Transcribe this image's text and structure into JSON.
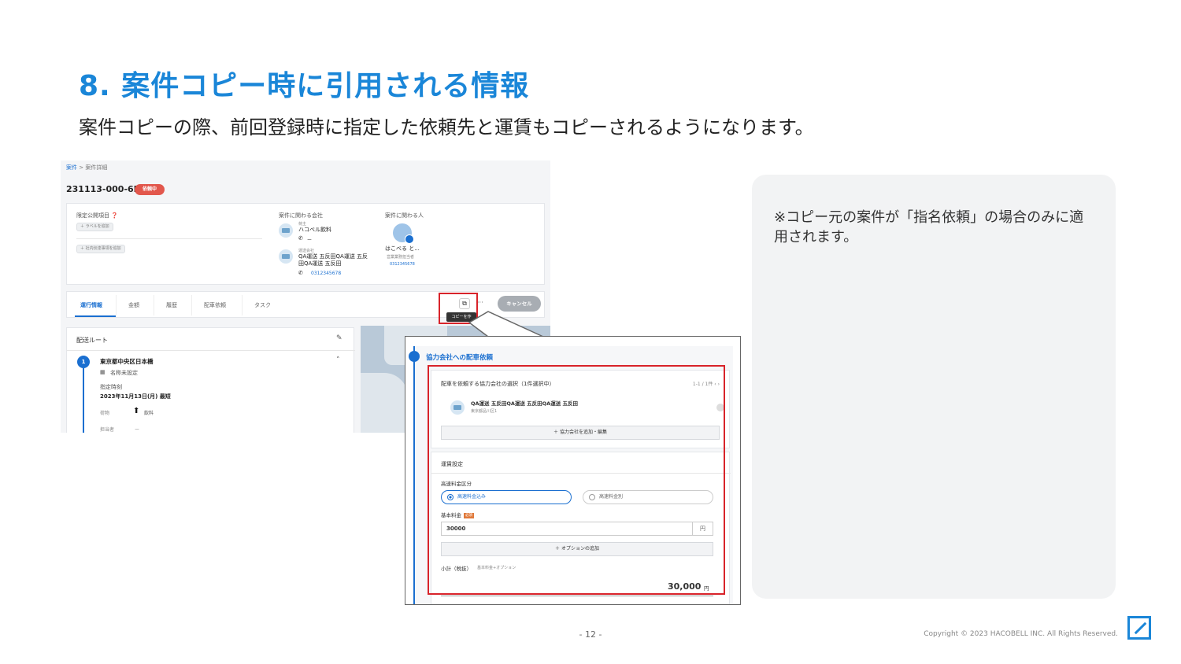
{
  "slide": {
    "title": "8. 案件コピー時に引用される情報",
    "subtitle": "案件コピーの際、前回登録時に指定した依頼先と運賃もコピーされるようになります。",
    "note": "※コピー元の案件が「指名依頼」の場合のみに適用されます。",
    "page_number": "- 12 -",
    "copyright": "Copyright © 2023 HACOBELL INC. All Rights Reserved."
  },
  "screen": {
    "breadcrumb": {
      "root": "案件",
      "sep": ">",
      "current": "案件詳細"
    },
    "case_id": "231113-000-6BR",
    "status": "依頼中",
    "info": {
      "limited_label": "限定公開項目 ❓",
      "add_label_pill": "＋ ラベルを追加",
      "add_internal_pill": "＋ 社内伝達事項を追加",
      "companies_label": "案件に関わる会社",
      "company1_role": "荷主",
      "company1_name": "ハコベル飲料",
      "company1_phone": "ー",
      "company2_role": "運送会社",
      "company2_name": "QA運送 五反田QA運送 五反田QA運送 五反田",
      "company2_phone": "0312345678",
      "people_label": "案件に関わる人",
      "person_name": "はこべる と...",
      "person_dept": "営業業務担当者",
      "person_phone": "0312345678"
    },
    "tabs": [
      "運行情報",
      "金額",
      "履歴",
      "配車依頼",
      "タスク"
    ],
    "copy_tooltip": "コピーを作",
    "more": "···",
    "cancel": "キャンセル",
    "route": {
      "title": "配送ルート",
      "stop_number": "1",
      "stop_name": "東京都中央区日本橋",
      "place_name": "名称未設定",
      "time_label": "指定時刻",
      "time_value": "2023年11月13日(月) 最短",
      "cargo_label": "荷物",
      "cargo_value": "飲料",
      "handler_label": "担当者",
      "handler_value": "ー"
    }
  },
  "zoom": {
    "header": "協力会社への配車依頼",
    "select_title": "配車を依頼する協力会社の選択（1件選択中）",
    "pagination": "1-1 / 1件   ‹   ›",
    "partner_name": "QA運送 五反田QA運送 五反田QA運送 五反田",
    "partner_address": "東京都品川区1",
    "add_partner": "＋ 協力会社を追加・編集",
    "fare_title": "運賃設定",
    "toll_label": "高速料金区分",
    "toll_included": "高速料金込み",
    "toll_excluded": "高速料金別",
    "base_label": "基本料金",
    "required": "必須",
    "base_value": "30000",
    "unit": "円",
    "add_option": "＋ オプションの追加",
    "subtotal_label": "小計（税抜）",
    "subtotal_note": "基本料金+オプション",
    "subtotal_value": "30,000",
    "subtotal_unit": "円"
  }
}
